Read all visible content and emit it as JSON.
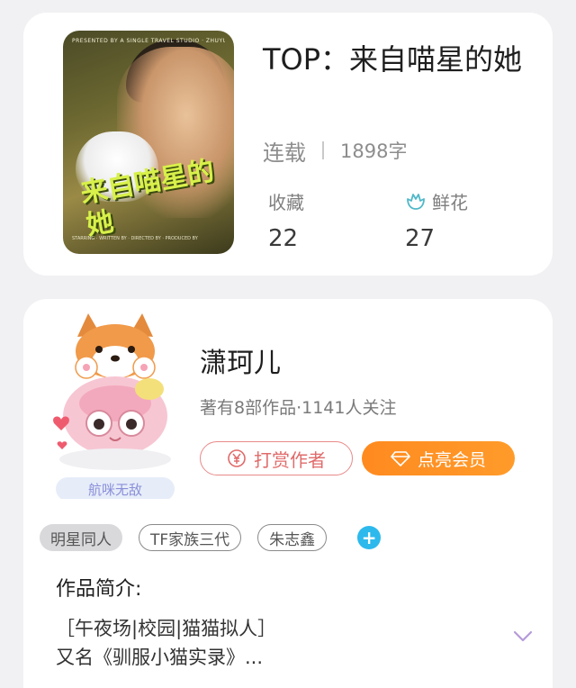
{
  "book": {
    "title": "TOP：来自喵星的她",
    "status": "连载",
    "word_count": "1898字",
    "stats": [
      {
        "label": "收藏",
        "value": "22",
        "icon": "none"
      },
      {
        "label": "鲜花",
        "value": "27",
        "icon": "flower-icon"
      }
    ],
    "cover": {
      "title_art": "来自喵星的她",
      "top_text": "PRESENTED BY A SINGLE TRAVEL STUDIO · ZHUYUJIALIN · SEENARY",
      "bottom_text": "STARRING · WRITTEN BY · DIRECTED BY · PRODUCED BY"
    }
  },
  "author": {
    "name": "潇珂儿",
    "info": "著有8部作品·1141人关注",
    "avatar_badge": "航咪无敌",
    "reward_button": "打赏作者",
    "vip_button": "点亮会员"
  },
  "tags": [
    {
      "label": "明星同人",
      "style": "filled"
    },
    {
      "label": "TF家族三代",
      "style": "outline"
    },
    {
      "label": "朱志鑫",
      "style": "outline"
    }
  ],
  "intro": {
    "heading": "作品简介:",
    "line1": "［午夜场|校园|猫猫拟人］",
    "line2": "又名《驯服小猫实录》..."
  },
  "colors": {
    "accent_orange": "#ff8a1f",
    "reward_red": "#e06b6b",
    "tag_add_blue": "#2db9ec",
    "flower_teal": "#4fb8c8"
  }
}
